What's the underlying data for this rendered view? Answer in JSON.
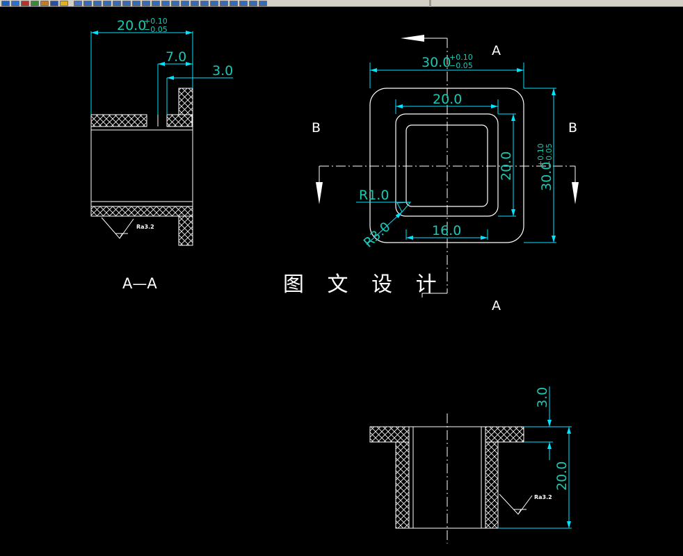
{
  "toolbar": {
    "buttons": [
      {
        "icon": "layer-icon",
        "color": "#1f5fbf"
      },
      {
        "icon": "table-icon",
        "color": "#2b6fd1"
      },
      {
        "icon": "gear-icon",
        "color": "#b0352a"
      },
      {
        "icon": "color-icon",
        "color": "#3a8a3a"
      },
      {
        "icon": "properties-icon",
        "color": "#c07a2a"
      },
      {
        "icon": "chart-icon",
        "color": "#2a4fa0"
      },
      {
        "icon": "folder-icon",
        "color": "#e0b020"
      },
      {
        "icon": "hatch-icon",
        "color": "#4a74c4"
      },
      {
        "icon": "dim-linear-icon",
        "color": "#3a6ab0"
      },
      {
        "icon": "dim-aligned-icon",
        "color": "#3a6ab0"
      },
      {
        "icon": "dim-radius-icon",
        "color": "#3a6ab0"
      },
      {
        "icon": "dim-angle-icon",
        "color": "#3a6ab0"
      },
      {
        "icon": "dim-diameter-icon",
        "color": "#3a6ab0"
      },
      {
        "icon": "dim-baseline-icon",
        "color": "#3a6ab0"
      },
      {
        "icon": "dim-continue-icon",
        "color": "#3a6ab0"
      },
      {
        "icon": "leader-icon",
        "color": "#3a6ab0"
      },
      {
        "icon": "tolerance-icon",
        "color": "#3a6ab0"
      },
      {
        "icon": "center-mark-icon",
        "color": "#3a6ab0"
      },
      {
        "icon": "dim-edit-icon",
        "color": "#3a6ab0"
      },
      {
        "icon": "dim-text-edit-icon",
        "color": "#3a6ab0"
      },
      {
        "icon": "dim-update-icon",
        "color": "#3a6ab0"
      },
      {
        "icon": "dim-style-icon",
        "color": "#3a6ab0"
      },
      {
        "icon": "dim-override-icon",
        "color": "#3a6ab0"
      },
      {
        "icon": "dim-space-icon",
        "color": "#3a6ab0"
      },
      {
        "icon": "dim-break-icon",
        "color": "#3a6ab0"
      },
      {
        "icon": "inspect-icon",
        "color": "#3a6ab0"
      },
      {
        "icon": "jogged-icon",
        "color": "#3a6ab0"
      }
    ]
  },
  "drawing": {
    "colors": {
      "background": "#000000",
      "outline": "#ffffff",
      "dimension": "#00e5ff",
      "dimension_text": "#19c8b4",
      "centerline": "#ffffff",
      "label": "#ffffff"
    },
    "section_view": {
      "dim_width": "20.0",
      "dim_width_tol_upper": "+0.10",
      "dim_width_tol_lower": "−0.05",
      "dim_flange": "7.0",
      "dim_wall": "3.0",
      "roughness": "Ra3.2",
      "caption": "A—A"
    },
    "top_view": {
      "dim_outer_width": "30.0",
      "dim_outer_width_tol_upper": "+0.10",
      "dim_outer_width_tol_lower": "−0.05",
      "dim_inner_width": "20.0",
      "dim_inner_height": "20.0",
      "dim_outer_height": "30.0",
      "dim_outer_height_tol_upper": "+0.10",
      "dim_outer_height_tol_lower": "−0.05",
      "dim_bottom": "16.0",
      "dim_inner_radius": "R1.0",
      "dim_outer_radius": "R3.0",
      "section_label_a_top": "A",
      "section_label_a_bottom": "A",
      "section_label_b_left": "B",
      "section_label_b_right": "B"
    },
    "front_view": {
      "dim_flange": "3.0",
      "dim_height": "20.0",
      "roughness": "Ra3.2"
    },
    "watermark": "图 文 设 计"
  }
}
